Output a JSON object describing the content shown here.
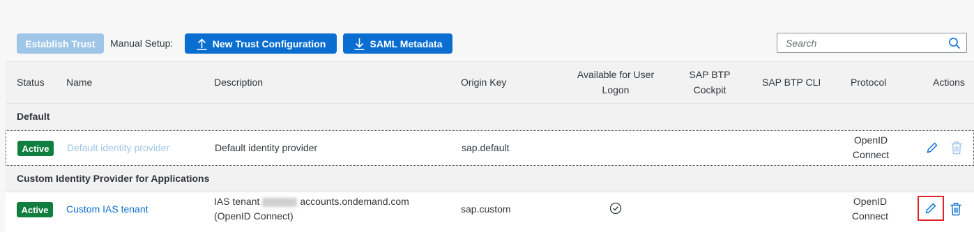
{
  "toolbar": {
    "establish_trust": "Establish Trust",
    "manual_setup_label": "Manual Setup:",
    "new_trust_configuration": "New Trust Configuration",
    "saml_metadata": "SAML Metadata",
    "search_placeholder": "Search"
  },
  "table": {
    "columns": {
      "status": "Status",
      "name": "Name",
      "description": "Description",
      "origin_key": "Origin Key",
      "available_for_user_logon_line1": "Available for User",
      "available_for_user_logon_line2": "Logon",
      "sap_btp_cockpit_line1": "SAP BTP",
      "sap_btp_cockpit_line2": "Cockpit",
      "sap_btp_cli": "SAP BTP CLI",
      "protocol": "Protocol",
      "actions": "Actions"
    },
    "groups": [
      {
        "title": "Default",
        "rows": [
          {
            "status": "Active",
            "name": "Default identity provider",
            "description": "Default identity provider",
            "origin_key": "sap.default",
            "protocol_line1": "OpenID",
            "protocol_line2": "Connect"
          }
        ]
      },
      {
        "title": "Custom Identity Provider for Applications",
        "rows": [
          {
            "status": "Active",
            "name": "Custom IAS tenant",
            "description_line1_prefix": "IAS tenant",
            "description_line1_suffix": "accounts.ondemand.com",
            "description_line2": "(OpenID Connect)",
            "origin_key": "sap.custom",
            "available_for_user_logon": true,
            "protocol_line1": "OpenID",
            "protocol_line2": "Connect"
          }
        ]
      }
    ]
  },
  "colors": {
    "primary": "#0a6ed1",
    "primary_disabled": "#9fc5e8",
    "active_badge": "#107e3e",
    "highlight": "#e0242a"
  }
}
